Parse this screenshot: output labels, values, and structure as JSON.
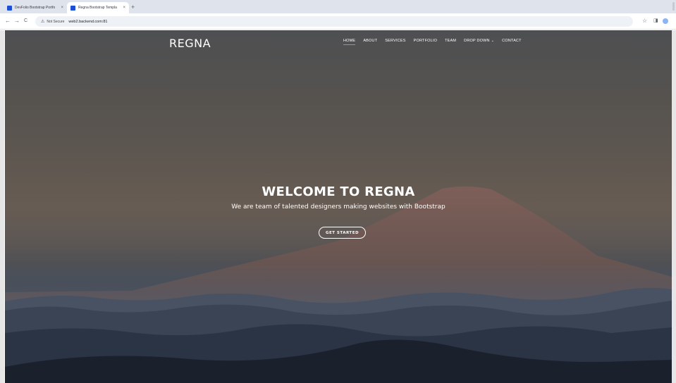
{
  "browser": {
    "tabs": [
      {
        "title": "DevFolio Bootstrap Portfolio",
        "active": false
      },
      {
        "title": "Regna Bootstrap Template",
        "active": true
      }
    ],
    "new_tab_label": "+",
    "close_label": "×",
    "back_label": "←",
    "forward_label": "→",
    "reload_label": "C",
    "security_text": "Not Secure",
    "url": "web2.backend.com:81",
    "star_label": "☆",
    "sidepanel_label": "◨"
  },
  "site": {
    "brand": "REGNA",
    "nav": [
      {
        "label": "HOME",
        "active": true
      },
      {
        "label": "ABOUT"
      },
      {
        "label": "SERVICES"
      },
      {
        "label": "PORTFOLIO"
      },
      {
        "label": "TEAM"
      },
      {
        "label": "DROP DOWN",
        "dropdown": true
      },
      {
        "label": "CONTACT"
      }
    ],
    "hero": {
      "title": "WELCOME TO REGNA",
      "subtitle": "We are team of talented designers making websites with Bootstrap",
      "cta": "GET STARTED"
    }
  },
  "colors": {
    "accent": "#2dc997",
    "favicon": "#1d4ed8",
    "tabstrip": "#dfe3eb"
  },
  "icons": {
    "favicon": "square-favicon-icon",
    "warning": "warning-triangle-icon",
    "star": "star-icon",
    "profile": "profile-icon",
    "dropdown": "chevron-down-icon"
  }
}
